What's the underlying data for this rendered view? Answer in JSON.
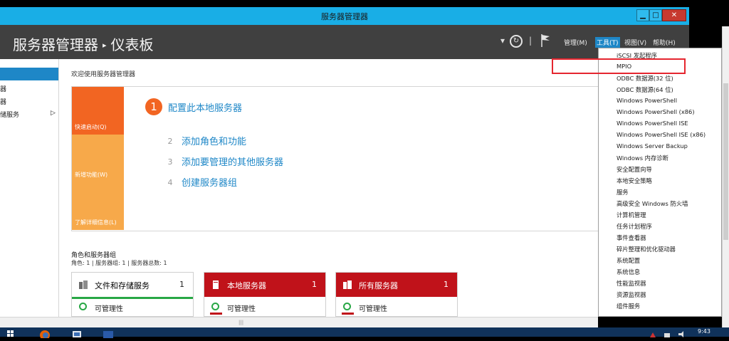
{
  "window": {
    "title": "服务器管理器",
    "minimize": "▁",
    "maximize": "□",
    "close": "✕"
  },
  "header": {
    "app_name": "服务器管理器",
    "separator": "▸",
    "page": "仪表板",
    "dropdown_arrow": "▾",
    "refresh_icon": "refresh-icon",
    "divider": "|",
    "flag_icon": "flag-icon",
    "menus": {
      "manage": "管理(M)",
      "tools": "工具(T)",
      "view": "视图(V)",
      "help": "帮助(H)"
    }
  },
  "sidebar": {
    "items": [
      {
        "label": ""
      },
      {
        "label": "器"
      },
      {
        "label": "器"
      },
      {
        "label": "储服务",
        "arrow": "▷"
      }
    ]
  },
  "welcome": {
    "title": "欢迎使用服务器管理器",
    "tiles": {
      "quick_start": "快速启动(Q)",
      "new_features": "新增功能(W)",
      "learn_more": "了解详细信息(L)"
    },
    "steps": [
      {
        "num": "1",
        "text": "配置此本地服务器"
      },
      {
        "num": "2",
        "text": "添加角色和功能"
      },
      {
        "num": "3",
        "text": "添加要管理的其他服务器"
      },
      {
        "num": "4",
        "text": "创建服务器组"
      }
    ]
  },
  "roles": {
    "title": "角色和服务器组",
    "subtitle": "角色: 1 | 服务器组: 1 | 服务器总数: 1",
    "tiles": [
      {
        "name": "文件和存储服务",
        "count": "1",
        "status": "可管理性"
      },
      {
        "name": "本地服务器",
        "count": "1",
        "status": "可管理性"
      },
      {
        "name": "所有服务器",
        "count": "1",
        "status": "可管理性"
      }
    ]
  },
  "tools_menu": {
    "items": [
      "iSCSI 发起程序",
      "MPIO",
      "ODBC 数据源(32 位)",
      "ODBC 数据源(64 位)",
      "Windows PowerShell",
      "Windows PowerShell (x86)",
      "Windows PowerShell ISE",
      "Windows PowerShell ISE (x86)",
      "Windows Server Backup",
      "Windows 内存诊断",
      "安全配置向导",
      "本地安全策略",
      "服务",
      "高级安全 Windows 防火墙",
      "计算机管理",
      "任务计划程序",
      "事件查看器",
      "碎片整理和优化驱动器",
      "系统配置",
      "系统信息",
      "性能监视器",
      "资源监视器",
      "组件服务"
    ],
    "highlighted": "MPIO"
  },
  "scrollbar": {
    "grip": "|||"
  },
  "taskbar": {
    "clock": "9:43"
  },
  "colors": {
    "accent": "#1e87c7",
    "title_bar": "#19aee6",
    "header": "#404040",
    "orange": "#f26522",
    "red": "#c0121a",
    "highlight_box": "#e5262f"
  }
}
